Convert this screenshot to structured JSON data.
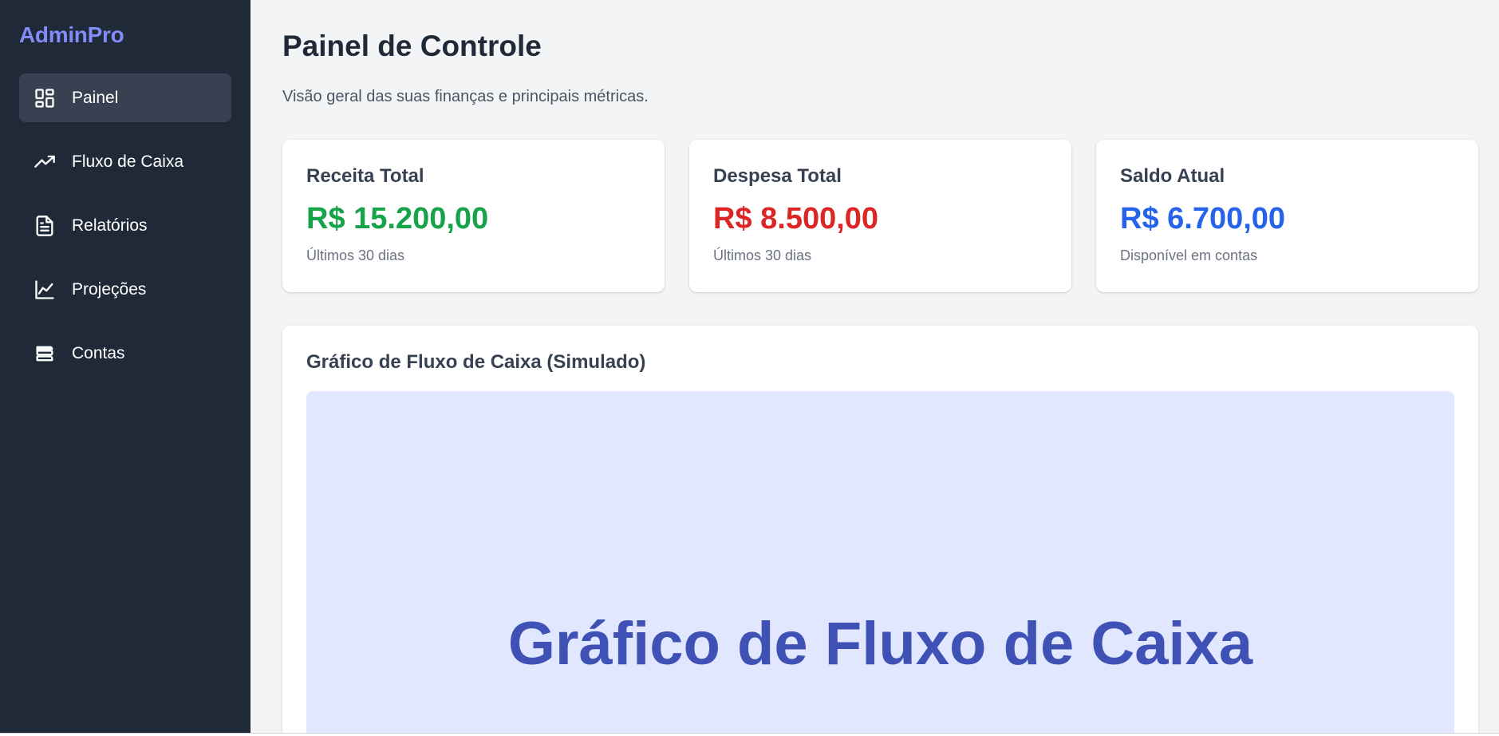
{
  "app": {
    "name": "AdminPro"
  },
  "sidebar": {
    "items": [
      {
        "label": "Painel",
        "icon": "dashboard-icon",
        "active": true
      },
      {
        "label": "Fluxo de Caixa",
        "icon": "trending-up-icon",
        "active": false
      },
      {
        "label": "Relatórios",
        "icon": "document-icon",
        "active": false
      },
      {
        "label": "Projeções",
        "icon": "line-chart-icon",
        "active": false
      },
      {
        "label": "Contas",
        "icon": "stacked-accounts-icon",
        "active": false
      }
    ]
  },
  "header": {
    "title": "Painel de Controle",
    "subtitle": "Visão geral das suas finanças e principais métricas."
  },
  "cards": [
    {
      "title": "Receita Total",
      "value": "R$ 15.200,00",
      "note": "Últimos 30 dias",
      "color": "#16a34a"
    },
    {
      "title": "Despesa Total",
      "value": "R$ 8.500,00",
      "note": "Últimos 30 dias",
      "color": "#dc2626"
    },
    {
      "title": "Saldo Atual",
      "value": "R$ 6.700,00",
      "note": "Disponível em contas",
      "color": "#2563eb"
    }
  ],
  "chart_panel": {
    "title": "Gráfico de Fluxo de Caixa (Simulado)",
    "placeholder_text": "Gráfico de Fluxo de Caixa"
  },
  "colors": {
    "sidebar_bg": "#1f2937",
    "sidebar_active": "#374151",
    "logo": "#818cf8",
    "main_bg": "#f3f4f6",
    "placeholder_bg": "#e0e7ff",
    "placeholder_text": "#3f51b5"
  }
}
